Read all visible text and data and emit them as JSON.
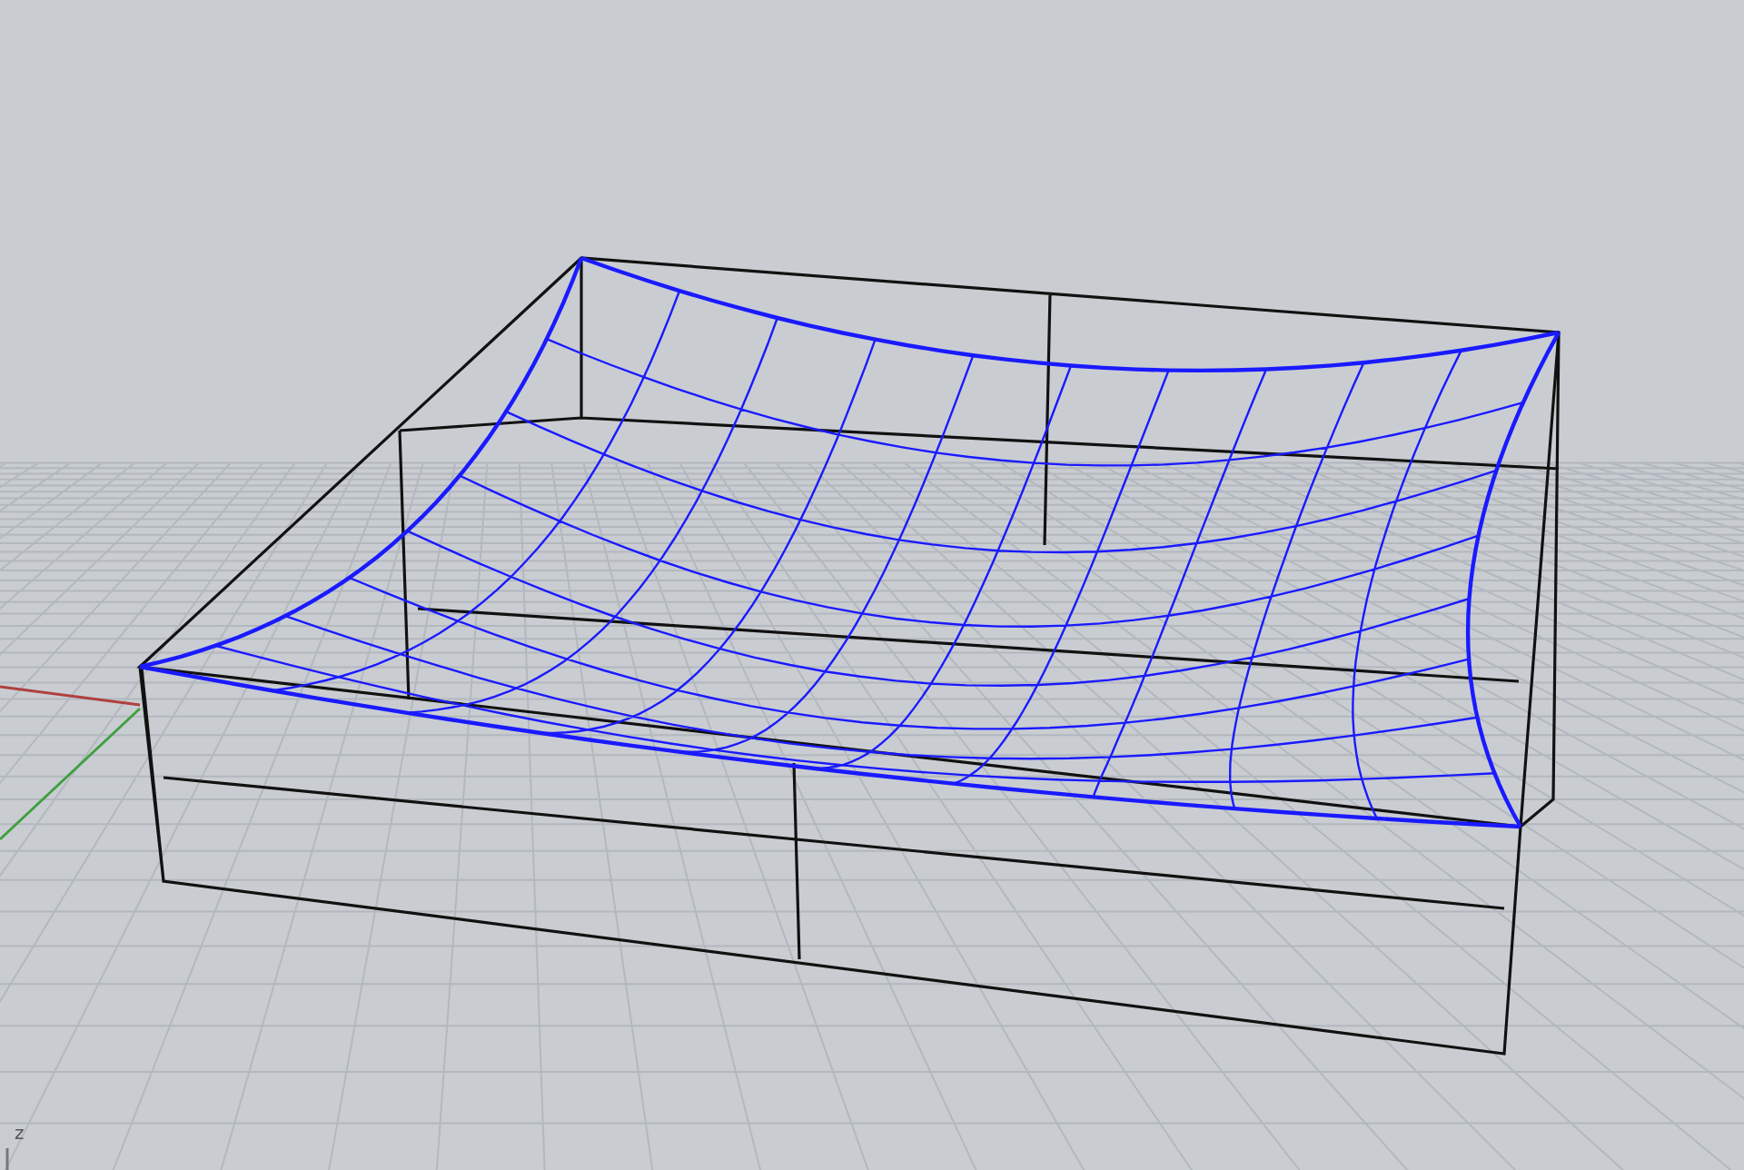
{
  "viewport": {
    "axis_label": "z"
  }
}
